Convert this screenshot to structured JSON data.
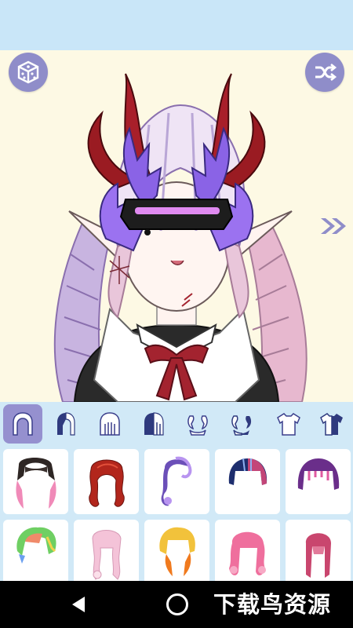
{
  "app": {
    "accent_color": "#8f8dc9",
    "category_bar_color": "#d1e9f7",
    "canvas_color": "#fdf9e4"
  },
  "toolbar": {
    "random_button_icon": "dice-icon",
    "shuffle_button_icon": "shuffle-icon",
    "next_icon": "double-chevron-right-icon"
  },
  "categories": [
    {
      "icon": "hair-front-icon",
      "selected": true
    },
    {
      "icon": "hair-front-variant-icon",
      "selected": false
    },
    {
      "icon": "hair-back-icon",
      "selected": false
    },
    {
      "icon": "hair-back-variant-icon",
      "selected": false
    },
    {
      "icon": "horns-icon",
      "selected": false
    },
    {
      "icon": "horns-variant-icon",
      "selected": false
    },
    {
      "icon": "shirt-icon",
      "selected": false
    },
    {
      "icon": "shirt-variant-icon",
      "selected": false
    }
  ],
  "hair_items": [
    {
      "name": "black-pink-twintail-hair",
      "colors": [
        "#2e2624",
        "#f08ab8"
      ]
    },
    {
      "name": "red-wavy-hair",
      "colors": [
        "#b2261c",
        "#e2503a"
      ]
    },
    {
      "name": "purple-curly-hair",
      "colors": [
        "#6b4fb8",
        "#b894f0"
      ]
    },
    {
      "name": "navy-pink-bob-hair",
      "colors": [
        "#1e2e6e",
        "#e14a7a"
      ]
    },
    {
      "name": "purple-magenta-bob-hair",
      "colors": [
        "#6a2e8a",
        "#e05aa0"
      ]
    },
    {
      "name": "rainbow-messy-hair",
      "colors": [
        "#6fcf63",
        "#f08a6a"
      ]
    },
    {
      "name": "pink-long-curly-hair",
      "colors": [
        "#f4c3d8",
        "#fbe0ea"
      ]
    },
    {
      "name": "yellow-orange-hair",
      "colors": [
        "#f2c23b",
        "#f07a1e"
      ]
    },
    {
      "name": "pink-curly-hair",
      "colors": [
        "#ef6f9d",
        "#f7a9c5"
      ]
    },
    {
      "name": "rose-long-hair",
      "colors": [
        "#c9466e",
        "#e27a9a"
      ]
    }
  ],
  "navigation": {
    "back_icon": "back-triangle-icon",
    "home_icon": "home-circle-icon"
  },
  "watermark": {
    "text": "下载鸟资源"
  }
}
